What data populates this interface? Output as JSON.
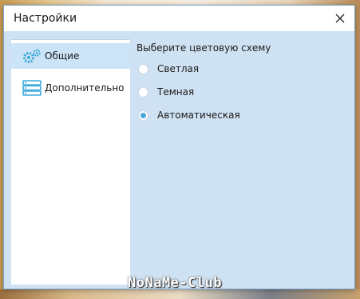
{
  "window": {
    "title": "Настройки",
    "close_icon": "close-icon"
  },
  "sidebar": {
    "items": [
      {
        "label": "Общие",
        "icon": "gears-icon",
        "selected": true
      },
      {
        "label": "Дополнительно",
        "icon": "list-icon",
        "selected": false
      }
    ]
  },
  "main": {
    "heading": "Выберите цветовую схему",
    "options": [
      {
        "label": "Светлая",
        "checked": false
      },
      {
        "label": "Темная",
        "checked": false
      },
      {
        "label": "Автоматическая",
        "checked": true
      }
    ]
  },
  "watermark": "NoNaMe-Club",
  "colors": {
    "accent": "#4aa8d8",
    "panel_bg": "#cfe2f3",
    "selected_bg": "#cce4f7"
  }
}
